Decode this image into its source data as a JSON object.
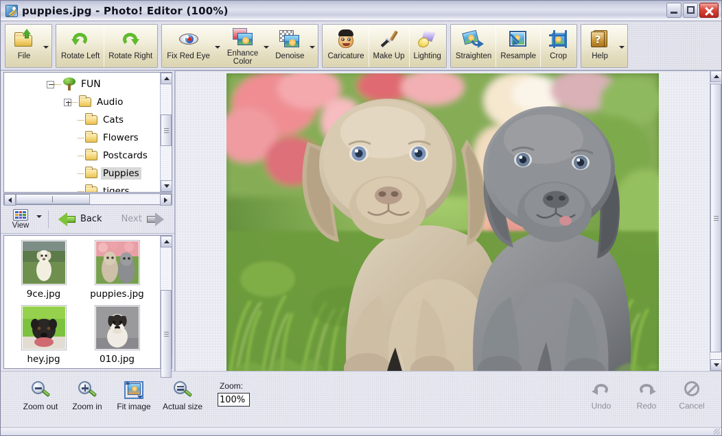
{
  "window": {
    "title": "puppies.jpg - Photo! Editor (100%)",
    "icon": "photo-editor-icon",
    "minimize_label": "Minimize",
    "maximize_label": "Maximize",
    "close_label": "Close"
  },
  "toolbar": {
    "groups": [
      {
        "name": "file-group",
        "buttons": [
          {
            "label": "File",
            "icon": "open-folder-icon",
            "has_dropdown": true
          }
        ]
      },
      {
        "name": "rotate-group",
        "buttons": [
          {
            "label": "Rotate Left",
            "icon": "rotate-left-icon",
            "has_dropdown": false
          },
          {
            "label": "Rotate Right",
            "icon": "rotate-right-icon",
            "has_dropdown": false
          }
        ]
      },
      {
        "name": "correction-group",
        "buttons": [
          {
            "label": "Fix Red Eye",
            "icon": "red-eye-icon",
            "has_dropdown": true
          },
          {
            "label": "Enhance\nColor",
            "icon": "enhance-color-icon",
            "has_dropdown": true
          },
          {
            "label": "Denoise",
            "icon": "denoise-icon",
            "has_dropdown": true
          }
        ]
      },
      {
        "name": "effects-group",
        "buttons": [
          {
            "label": "Caricature",
            "icon": "caricature-face-icon",
            "has_dropdown": false
          },
          {
            "label": "Make Up",
            "icon": "makeup-brush-icon",
            "has_dropdown": false
          },
          {
            "label": "Lighting",
            "icon": "lighting-lamp-icon",
            "has_dropdown": false
          }
        ]
      },
      {
        "name": "geometry-group",
        "buttons": [
          {
            "label": "Straighten",
            "icon": "straighten-icon",
            "has_dropdown": false
          },
          {
            "label": "Resample",
            "icon": "resample-icon",
            "has_dropdown": false
          },
          {
            "label": "Crop",
            "icon": "crop-icon",
            "has_dropdown": false
          }
        ]
      },
      {
        "name": "help-group",
        "buttons": [
          {
            "label": "Help",
            "icon": "help-book-icon",
            "has_dropdown": true
          }
        ]
      }
    ]
  },
  "tree": {
    "nodes": [
      {
        "label": "FUN",
        "icon": "tree-icon",
        "depth": 0,
        "toggle": "minus",
        "selected": false
      },
      {
        "label": "Audio",
        "icon": "folder-icon",
        "depth": 1,
        "toggle": "plus",
        "selected": false
      },
      {
        "label": "Cats",
        "icon": "folder-icon",
        "depth": 1,
        "toggle": "none",
        "selected": false
      },
      {
        "label": "Flowers",
        "icon": "folder-icon",
        "depth": 1,
        "toggle": "none",
        "selected": false
      },
      {
        "label": "Postcards",
        "icon": "folder-icon",
        "depth": 1,
        "toggle": "none",
        "selected": false
      },
      {
        "label": "Puppies",
        "icon": "folder-icon",
        "depth": 1,
        "toggle": "none",
        "selected": true
      },
      {
        "label": "tigers",
        "icon": "folder-icon",
        "depth": 1,
        "toggle": "none",
        "selected": false
      }
    ]
  },
  "navbar": {
    "view_label": "View",
    "view_icon": "view-grid-icon",
    "view_has_dropdown": true,
    "back_label": "Back",
    "back_enabled": true,
    "next_label": "Next",
    "next_enabled": false
  },
  "thumbnails": {
    "items": [
      {
        "name": "9ce.jpg",
        "selected": false
      },
      {
        "name": "puppies.jpg",
        "selected": false
      },
      {
        "name": "hey.jpg",
        "selected": false
      },
      {
        "name": "010.jpg",
        "selected": false
      },
      {
        "name": "",
        "selected": false
      }
    ]
  },
  "canvas": {
    "image_name": "puppies.jpg",
    "alt": "Two puppies sitting on grass in front of pink flowers"
  },
  "bottombar": {
    "zoom_out_label": "Zoom out",
    "zoom_in_label": "Zoom in",
    "fit_image_label": "Fit image",
    "actual_size_label": "Actual size",
    "zoom_field_label": "Zoom:",
    "zoom_value": "100%",
    "undo_label": "Undo",
    "undo_enabled": false,
    "redo_label": "Redo",
    "redo_enabled": false,
    "cancel_label": "Cancel",
    "cancel_enabled": false
  },
  "colors": {
    "titlebar_start": "#b9bdd4",
    "titlebar_end": "#f6f7fb",
    "toolbar_button": "#f2eedb",
    "close_button": "#d9473b",
    "selection": "#d8d8d8"
  }
}
